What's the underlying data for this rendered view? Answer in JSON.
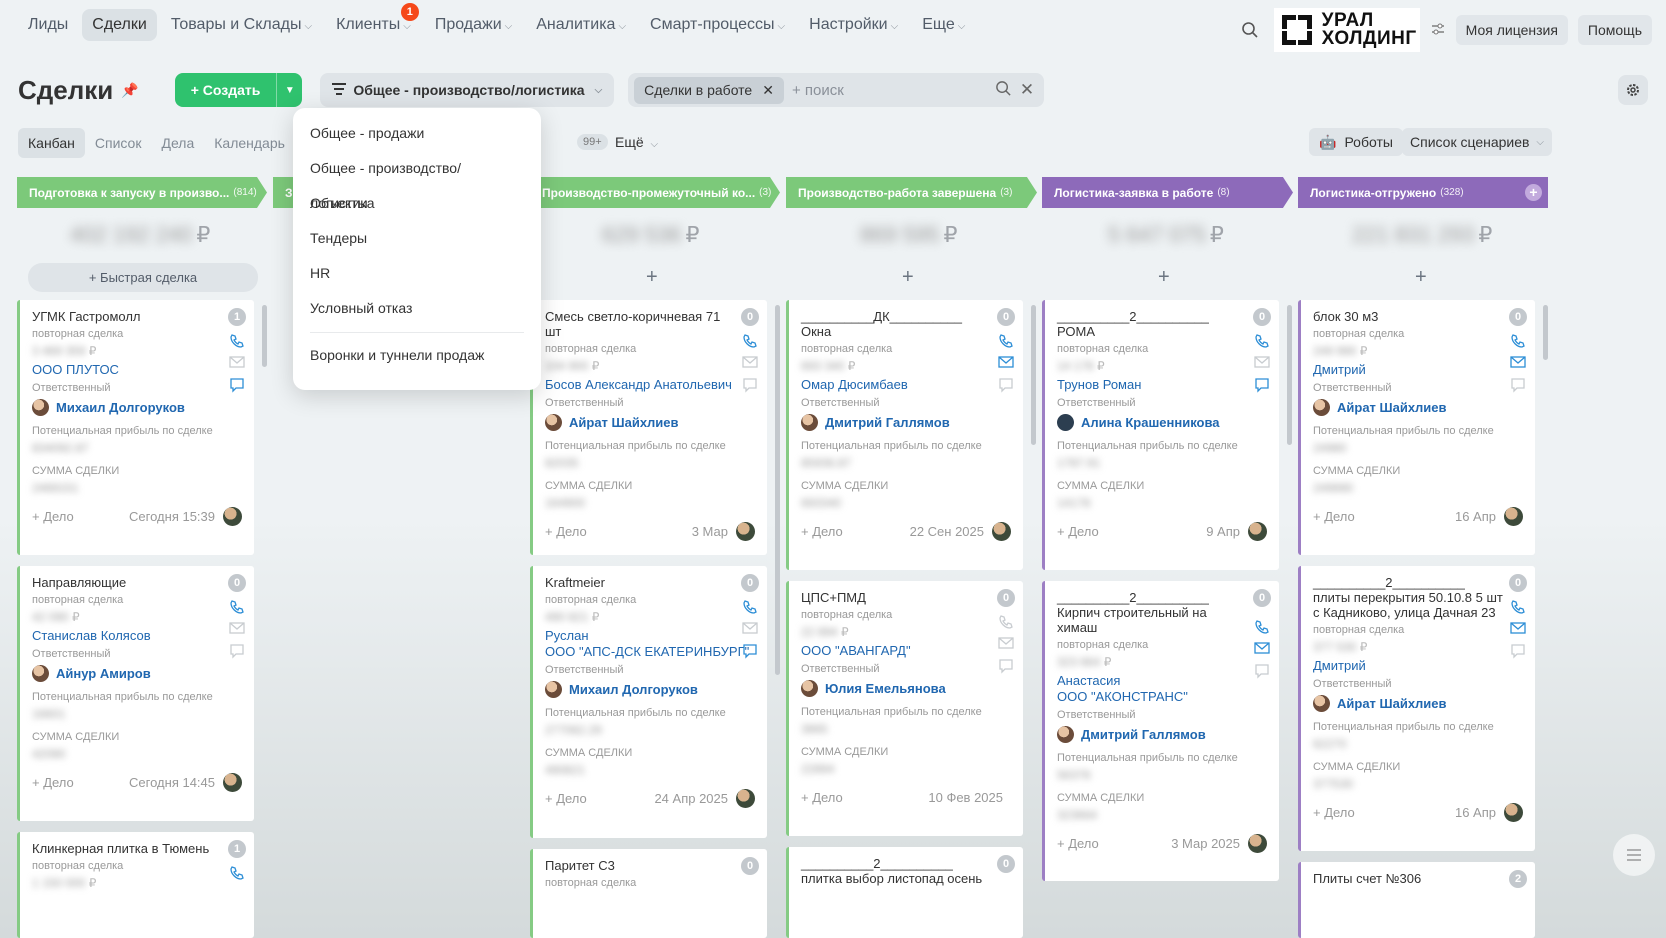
{
  "topnav": [
    {
      "label": "Лиды",
      "chev": false
    },
    {
      "label": "Сделки",
      "chev": false,
      "active": true
    },
    {
      "label": "Товары и Склады",
      "chev": true
    },
    {
      "label": "Клиенты",
      "chev": true,
      "badge": "1"
    },
    {
      "label": "Продажи",
      "chev": true
    },
    {
      "label": "Аналитика",
      "chev": true
    },
    {
      "label": "Смарт-процессы",
      "chev": true
    },
    {
      "label": "Настройки",
      "chev": true
    },
    {
      "label": "Еще",
      "chev": true
    }
  ],
  "logo": {
    "line1": "УРАЛ",
    "line2": "ХОЛДИНГ"
  },
  "top_buttons": {
    "license": "Моя лицензия",
    "help": "Помощь"
  },
  "page": {
    "title": "Сделки",
    "create": "+ Создать",
    "funnel": "Общее - производство/логистика",
    "filter_chip": "Сделки в работе",
    "search_placeholder": "+ поиск"
  },
  "views": [
    "Канбан",
    "Список",
    "Дела",
    "Календарь"
  ],
  "counter": "99+",
  "more": "Ещё",
  "robots": "Роботы",
  "scenarios": "Список сценариев",
  "dropdown": [
    "Общее - продажи",
    "Общее - производство/логистика",
    "Объекты",
    "Тендеры",
    "HR",
    "Условный отказ"
  ],
  "dropdown_footer": "Воронки и туннели продаж",
  "stages": [
    {
      "title": "Подготовка к запуску в произво...",
      "count": "(814)",
      "color": "#7cc97a"
    },
    {
      "title": "З",
      "count": "",
      "color": "#7cc97a"
    },
    {
      "title": "Производство-промежуточный ко...",
      "count": "(3)",
      "color": "#7cc97a"
    },
    {
      "title": "Производство-работа завершена",
      "count": "(3)",
      "color": "#7cc97a"
    },
    {
      "title": "Логистика-заявка в работе",
      "count": "(8)",
      "color": "#8d6aba"
    },
    {
      "title": "Логистика-отгружено",
      "count": "(328)",
      "color": "#8d6aba"
    }
  ],
  "sums": [
    "402 192 240",
    "629 536",
    "869 595",
    "5 647 075",
    "221 831 293"
  ],
  "currency": "₽",
  "quick_deal": "+ Быстрая сделка",
  "labels": {
    "repeat": "повторная сделка",
    "resp": "Ответственный",
    "profit": "Потенциальная прибыль по сделке",
    "sum": "СУММА СДЕЛКИ",
    "task": "+ Дело"
  },
  "cards": {
    "c1": [
      {
        "title": "УГМК Гастромолл",
        "num": "1",
        "price": "3 469 359",
        "client": "ООО ПЛУТОС",
        "person": "Михаил Долгоруков",
        "profit": "834092.87",
        "sumv": "2469151",
        "date": "Сегодня 15:39"
      },
      {
        "title": "Направляющие",
        "num": "0",
        "price": "42 090",
        "client": "Станислав Колясов",
        "person": "Айнур Амиров",
        "profit": "16601",
        "sumv": "42090",
        "date": "Сегодня 14:45"
      },
      {
        "title": "Клинкерная плитка в Тюмень",
        "num": "1",
        "price": "1 150 000"
      }
    ],
    "c3": [
      {
        "title": "Смесь светло-коричневая 71 шт",
        "num": "0",
        "price": "104 900",
        "client": "Босов Александр Анатольевич",
        "person": "Айрат Шайхлиев",
        "profit": "82035",
        "sumv": "164900",
        "date": "3 Мар"
      },
      {
        "title": "Kraftmeier",
        "num": "0",
        "price": "490 821",
        "client": "Руслан",
        "client2": "ООО \"АПС-ДСК ЕКАТЕРИНБУРГ\"",
        "person": "Михаил Долгоруков",
        "profit": "277062.29",
        "sumv": "490821",
        "date": "24 Апр 2025"
      },
      {
        "title": "Паритет С3",
        "num": "0"
      }
    ],
    "c4": [
      {
        "title": "__________ДК__________",
        "title2": "Окна",
        "num": "0",
        "price": "693 340",
        "client": "Омар Дюсимбаев",
        "person": "Дмитрий Галлямов",
        "profit": "85936.87",
        "sumv": "693340",
        "date": "22 Сен 2025"
      },
      {
        "title": "ЦПС+ПМД",
        "num": "0",
        "price": "22 894",
        "client": "ООО \"АВАНГАРД\"",
        "person": "Юлия Емельянова",
        "profit": "3865",
        "sumv": "22894",
        "date": "10 Фев 2025"
      },
      {
        "title": "__________2__________",
        "title2": "плитка выбор листопад осень",
        "num": "0"
      }
    ],
    "c5": [
      {
        "title": "__________2__________",
        "title2": "РОМА",
        "num": "0",
        "price": "14 178",
        "client": "Трунов Роман",
        "person": "Алина Крашенникова",
        "profit": "1787.91",
        "sumv": "14178",
        "date": "9 Апр"
      },
      {
        "title": "__________2__________",
        "title2": "Кирпич строительный на химаш",
        "num": "0",
        "price": "323 664",
        "client": "Анастасия",
        "client2": "ООО \"АКОНСТРАНС\"",
        "person": "Дмитрий Галлямов",
        "profit": "56378",
        "sumv": "323664",
        "date": "3 Мар 2025"
      }
    ],
    "c6": [
      {
        "title": "блок 30 м3",
        "num": "0",
        "price": "249 990",
        "client": "Дмитрий",
        "person": "Айрат Шайхлиев",
        "profit": "24980",
        "sumv": "249990",
        "date": "16 Апр"
      },
      {
        "title": "__________2__________",
        "title2": "плиты перекрытия 50.10.8 5 шт с Кадниково, улица Дачная 23",
        "num": "0",
        "price": "377 530",
        "client": "Дмитрий",
        "person": "Айрат Шайхлиев",
        "profit": "62270",
        "sumv": "377530",
        "date": "16 Апр"
      },
      {
        "title": "Плиты счет №306",
        "num": "2"
      }
    ]
  }
}
